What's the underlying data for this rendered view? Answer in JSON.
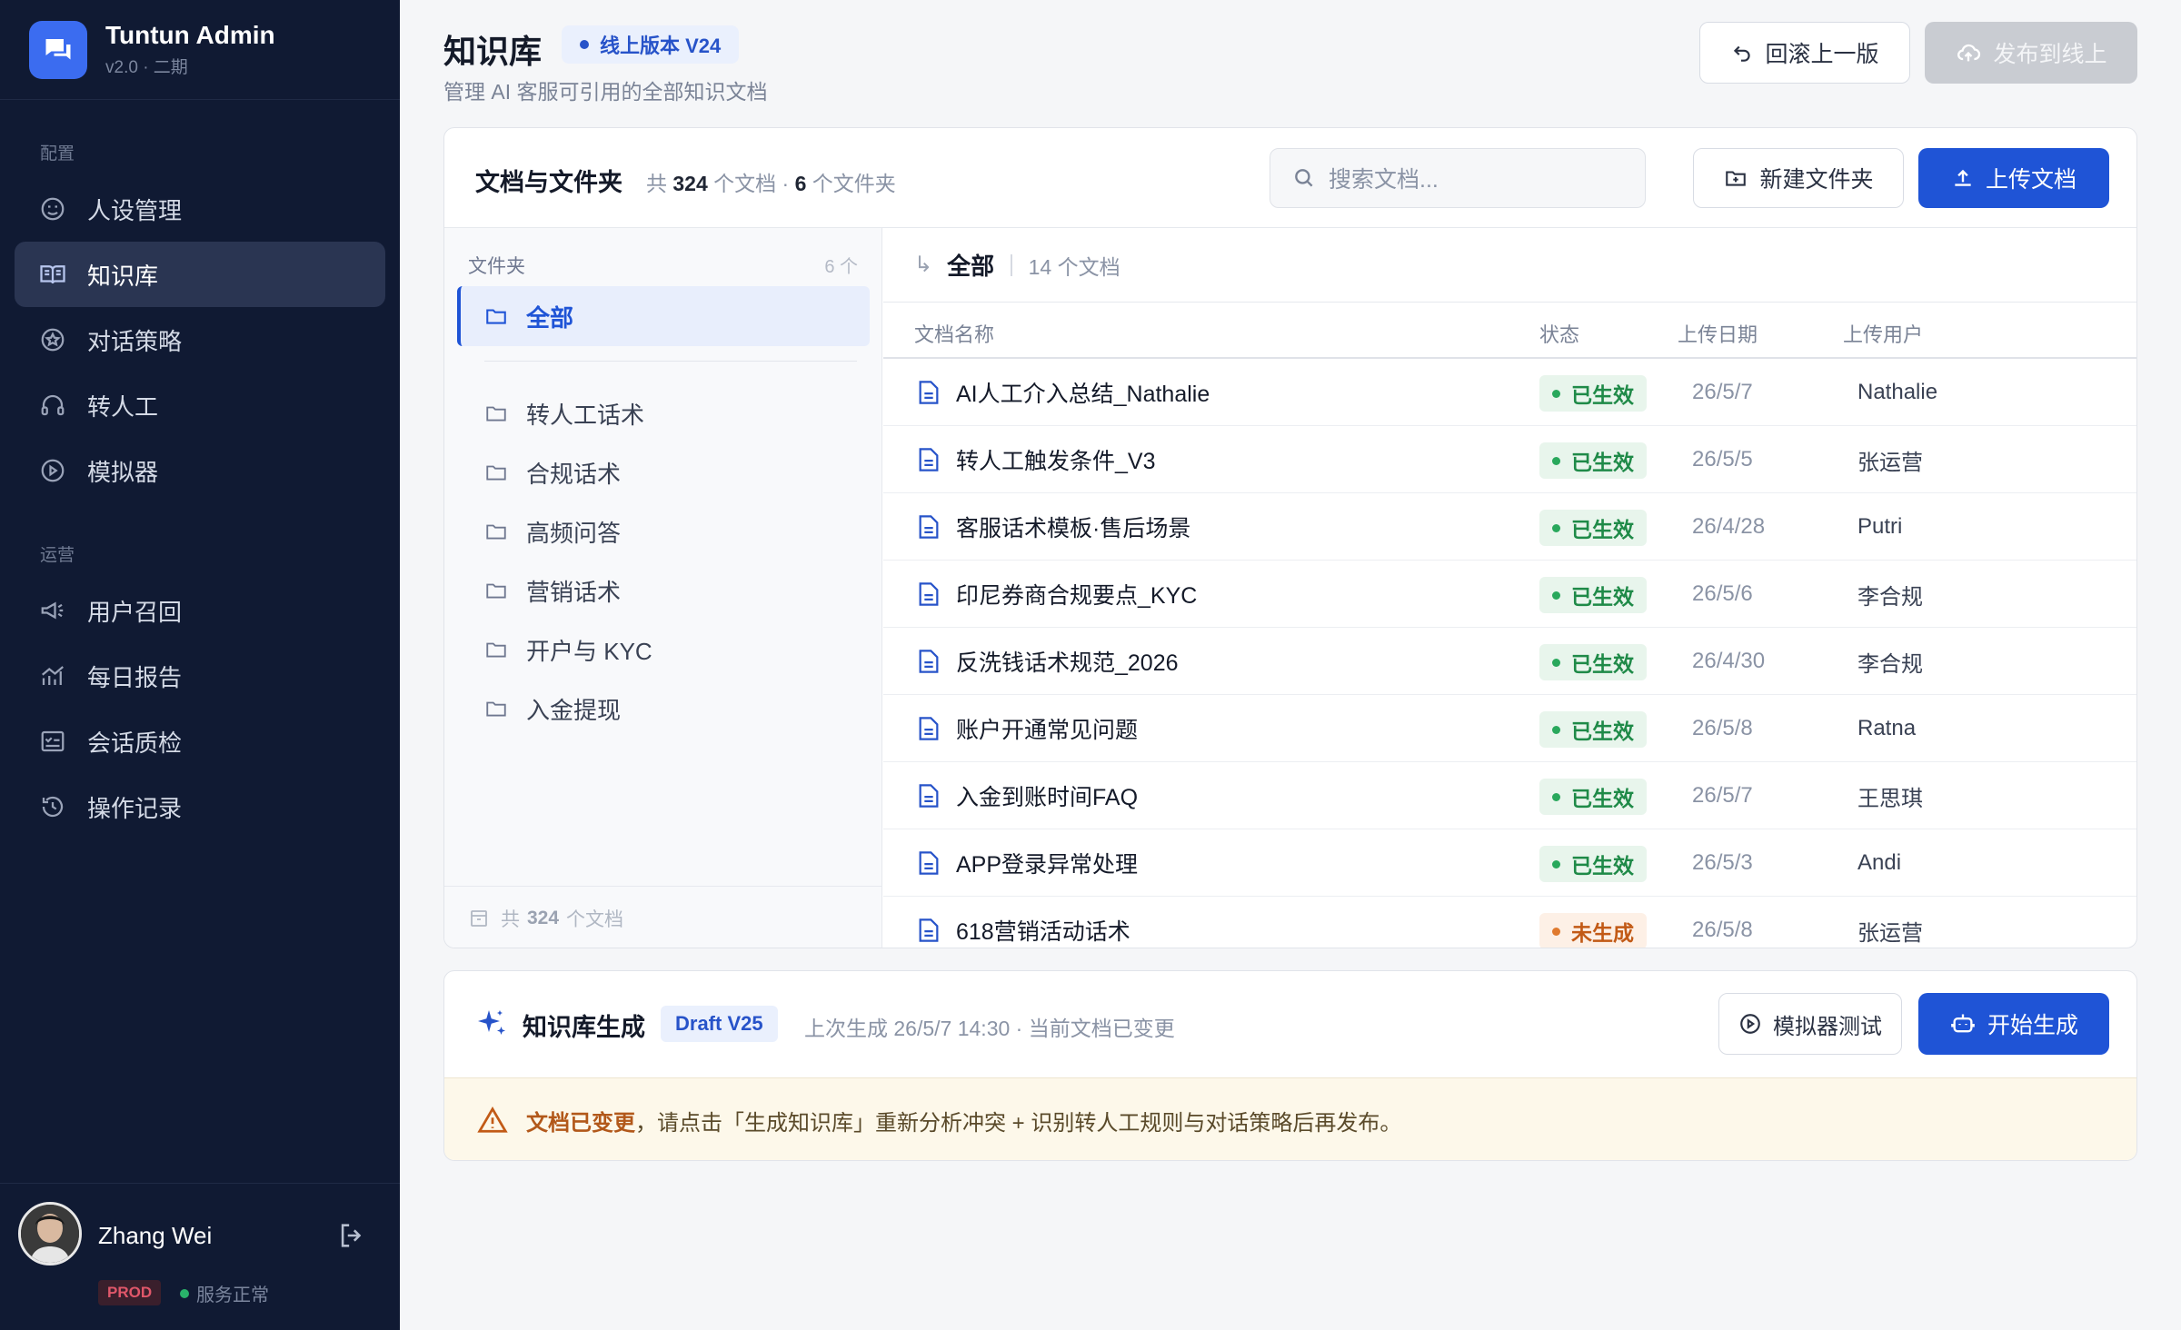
{
  "brand": {
    "title": "Tuntun Admin",
    "subtitle": "v2.0 · 二期"
  },
  "sidebar": {
    "section_config": "配置",
    "section_ops": "运营",
    "config_items": [
      {
        "label": "人设管理",
        "icon": "persona-icon"
      },
      {
        "label": "知识库",
        "icon": "book-icon",
        "active": true
      },
      {
        "label": "对话策略",
        "icon": "star-circle-icon"
      },
      {
        "label": "转人工",
        "icon": "headset-icon"
      },
      {
        "label": "模拟器",
        "icon": "play-circle-icon"
      }
    ],
    "ops_items": [
      {
        "label": "用户召回",
        "icon": "megaphone-icon"
      },
      {
        "label": "每日报告",
        "icon": "chart-icon"
      },
      {
        "label": "会话质检",
        "icon": "checklist-icon"
      },
      {
        "label": "操作记录",
        "icon": "history-icon"
      }
    ]
  },
  "user": {
    "name": "Zhang Wei",
    "env": "PROD",
    "service_status": "服务正常"
  },
  "header": {
    "title": "知识库",
    "version": "线上版本 V24",
    "subtitle": "管理 AI 客服可引用的全部知识文档",
    "rollback_label": "回滚上一版",
    "publish_label": "发布到线上"
  },
  "panel": {
    "title": "文档与文件夹",
    "count_prefix": "共",
    "doc_count": "324",
    "doc_unit": "个文档 ·",
    "folder_count": "6",
    "folder_unit": "个文件夹",
    "search_placeholder": "搜索文档...",
    "new_folder_label": "新建文件夹",
    "upload_label": "上传文档"
  },
  "folders": {
    "label": "文件夹",
    "count": "6 个",
    "all_label": "全部",
    "items": [
      "转人工话术",
      "合规话术",
      "高频问答",
      "营销话术",
      "开户与 KYC",
      "入金提现"
    ],
    "footer_prefix": "共",
    "footer_count": "324",
    "footer_unit": "个文档"
  },
  "docs": {
    "crumb_arrow": "↳",
    "crumb_current": "全部",
    "crumb_count": "14 个文档",
    "columns": {
      "name": "文档名称",
      "status": "状态",
      "date": "上传日期",
      "user": "上传用户"
    },
    "rows": [
      {
        "name": "AI人工介入总结_Nathalie",
        "status": "已生效",
        "date": "26/5/7",
        "user": "Nathalie"
      },
      {
        "name": "转人工触发条件_V3",
        "status": "已生效",
        "date": "26/5/5",
        "user": "张运营"
      },
      {
        "name": "客服话术模板·售后场景",
        "status": "已生效",
        "date": "26/4/28",
        "user": "Putri"
      },
      {
        "name": "印尼券商合规要点_KYC",
        "status": "已生效",
        "date": "26/5/6",
        "user": "李合规"
      },
      {
        "name": "反洗钱话术规范_2026",
        "status": "已生效",
        "date": "26/4/30",
        "user": "李合规"
      },
      {
        "name": "账户开通常见问题",
        "status": "已生效",
        "date": "26/5/8",
        "user": "Ratna"
      },
      {
        "name": "入金到账时间FAQ",
        "status": "已生效",
        "date": "26/5/7",
        "user": "王思琪"
      },
      {
        "name": "APP登录异常处理",
        "status": "已生效",
        "date": "26/5/3",
        "user": "Andi"
      },
      {
        "name": "618营销活动话术",
        "status": "未生成",
        "date": "26/5/8",
        "user": "张运营"
      }
    ]
  },
  "generation": {
    "title": "知识库生成",
    "draft": "Draft V25",
    "info": "上次生成 26/5/7 14:30 · 当前文档已变更",
    "simulate_label": "模拟器测试",
    "start_label": "开始生成",
    "warning_bold": "文档已变更",
    "warning_text": "，请点击「生成知识库」重新分析冲突 + 识别转人工规则与对话策略后再发布。"
  },
  "colors": {
    "sidebar_bg": "#101a33",
    "accent": "#1f54d6",
    "active_status": "#1f8a48",
    "pending_status": "#c25a16",
    "warning_bg": "#fdf8ea"
  }
}
